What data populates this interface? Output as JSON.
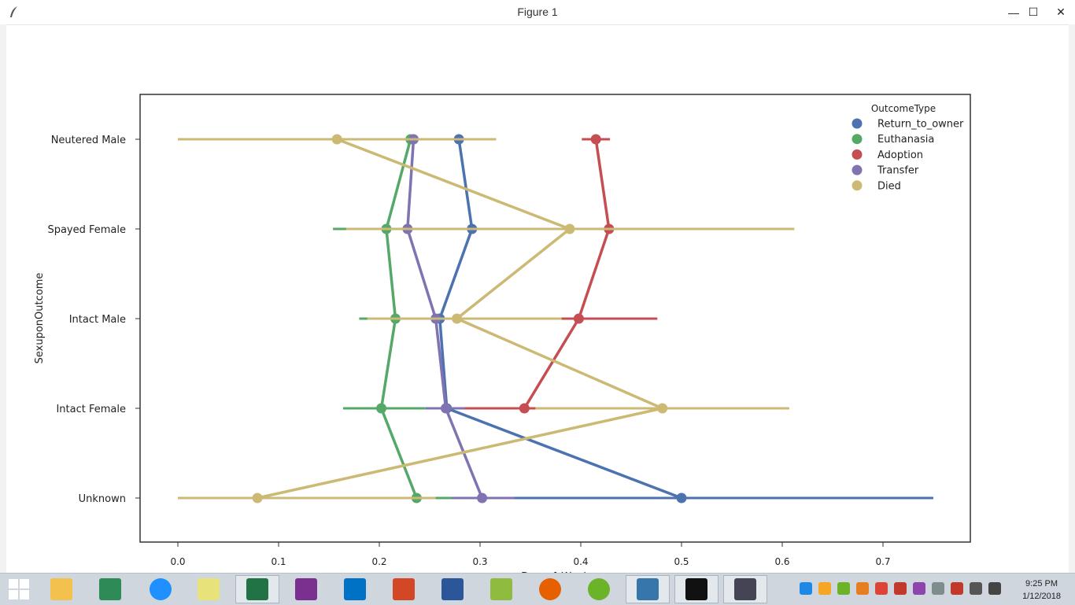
{
  "window": {
    "title": "Figure 1",
    "buttons": {
      "minimize": "—",
      "maximize": "☐",
      "close": "✕"
    }
  },
  "chart_data": {
    "type": "line",
    "orientation": "horizontal-pointplot",
    "xlabel": "Day_of_Week",
    "ylabel": "SexuponOutcome",
    "xlim": [
      -0.04,
      0.79
    ],
    "xticks": [
      "0.0",
      "0.1",
      "0.2",
      "0.3",
      "0.4",
      "0.5",
      "0.6",
      "0.7"
    ],
    "categories": [
      "Neutered Male",
      "Spayed Female",
      "Intact Male",
      "Intact Female",
      "Unknown"
    ],
    "legend": {
      "title": "OutcomeType",
      "placement": "top-right"
    },
    "series": [
      {
        "name": "Return_to_owner",
        "color": "#4c72b0",
        "values": [
          0.279,
          0.292,
          0.26,
          0.267,
          0.5
        ],
        "ci": [
          [
            0.275,
            0.283
          ],
          [
            0.287,
            0.297
          ],
          [
            0.255,
            0.265
          ],
          [
            0.262,
            0.272
          ],
          [
            0.25,
            0.75
          ]
        ]
      },
      {
        "name": "Euthanasia",
        "color": "#55a868",
        "values": [
          0.231,
          0.207,
          0.216,
          0.202,
          0.237
        ],
        "ci": [
          [
            0.226,
            0.236
          ],
          [
            0.154,
            0.262
          ],
          [
            0.18,
            0.253
          ],
          [
            0.164,
            0.246
          ],
          [
            0.201,
            0.273
          ]
        ]
      },
      {
        "name": "Adoption",
        "color": "#c44e52",
        "values": [
          0.415,
          0.428,
          0.398,
          0.344,
          null
        ],
        "ci": [
          [
            0.401,
            0.429
          ],
          [
            0.414,
            0.442
          ],
          [
            0.318,
            0.476
          ],
          [
            0.282,
            0.356
          ],
          null
        ]
      },
      {
        "name": "Transfer",
        "color": "#8172b2",
        "values": [
          0.234,
          0.228,
          0.256,
          0.266,
          0.302
        ],
        "ci": [
          [
            0.229,
            0.239
          ],
          [
            0.222,
            0.234
          ],
          [
            0.25,
            0.262
          ],
          [
            0.246,
            0.285
          ],
          [
            0.272,
            0.334
          ]
        ]
      },
      {
        "name": "Died",
        "color": "#ccb974",
        "values": [
          0.158,
          0.389,
          0.277,
          0.481,
          0.079
        ],
        "ci": [
          [
            0.0,
            0.316
          ],
          [
            0.167,
            0.612
          ],
          [
            0.188,
            0.381
          ],
          [
            0.355,
            0.607
          ],
          [
            0.0,
            0.256
          ]
        ]
      }
    ]
  },
  "taskbar": {
    "apps": [
      "start-icon",
      "file-explorer-icon",
      "store-icon",
      "internet-explorer-icon",
      "sticky-notes-icon",
      "excel-icon",
      "onenote-icon",
      "outlook-icon",
      "powerpoint-icon",
      "word-icon",
      "notepad-plus-icon",
      "firefox-icon",
      "utorrent-icon",
      "python-icon",
      "cmd-icon",
      "figure-feather-icon"
    ],
    "clock": {
      "time": "9:25 PM",
      "date": "1/12/2018"
    }
  }
}
